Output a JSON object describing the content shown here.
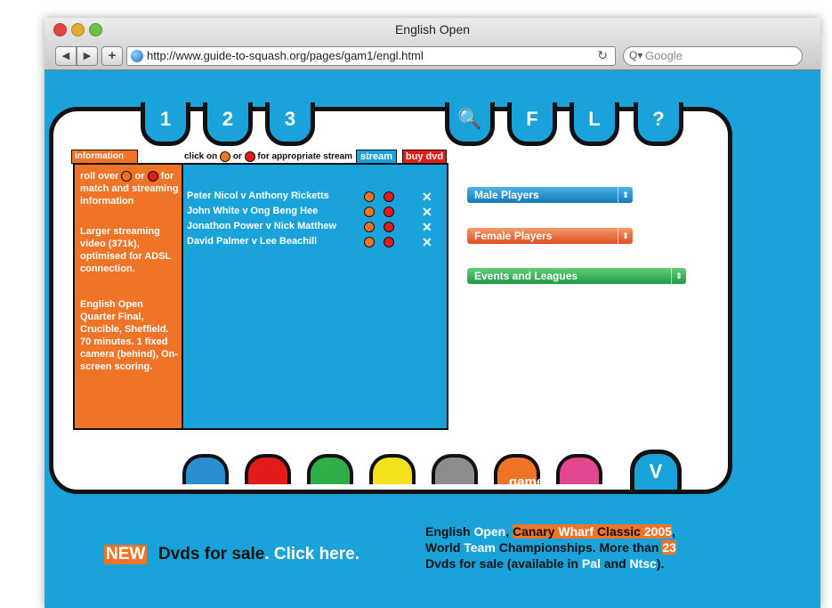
{
  "window": {
    "title": "English Open"
  },
  "toolbar": {
    "back": "◀",
    "forward": "▶",
    "add": "+",
    "url": "http://www.guide-to-squash.org/pages/gam1/engl.html",
    "reload": "↻",
    "search_placeholder": "Google",
    "search_icon": "Q▾"
  },
  "top_tabs": [
    "1",
    "2",
    "3",
    "🔍",
    "F",
    "L",
    "?"
  ],
  "info": {
    "tab": "information",
    "rollover_a": "roll over",
    "rollover_or": "or",
    "rollover_b": "for match and streaming information",
    "p2": "Larger streaming video (371k), optimised for ADSL connection.",
    "p3": "English Open Quarter Final, Crucible, Sheffield. 70 minutes. 1 fixed camera (behind), On-screen scoring."
  },
  "stream_header": {
    "click_on": "click on",
    "or": "or",
    "for": "for appropriate stream",
    "stream": "stream",
    "buy_dvd": "buy dvd"
  },
  "matches": [
    {
      "name": "Peter Nicol v Anthony Ricketts",
      "buy": "✕"
    },
    {
      "name": "John White v Ong Beng Hee",
      "buy": "✕"
    },
    {
      "name": "Jonathon Power v Nick Matthew",
      "buy": "✕"
    },
    {
      "name": "David Palmer v Lee Beachill",
      "buy": "✕"
    }
  ],
  "dropdowns": {
    "male": "Male Players",
    "female": "Female Players",
    "events": "Events and Leagues",
    "arrow": "⇕"
  },
  "bottom_tabs": {
    "game": "game",
    "v": "V"
  },
  "promo": {
    "new": "NEW",
    "left_a": "Dvds for sale",
    "left_b": ". Click here.",
    "line1_a": "English ",
    "line1_b": "Open",
    "line1_c": ", ",
    "line1_d": "Canary",
    "line1_e": " Wharf ",
    "line1_f": "Classic",
    "line1_g": " 2005",
    "line1_h": ",",
    "line2_a": "World ",
    "line2_b": "Team",
    "line2_c": " Championships. More than ",
    "line2_d": "23",
    "line3_a": "Dvds for sale (available in ",
    "line3_b": "Pal",
    "line3_c": " and ",
    "line3_d": "Ntsc",
    "line3_e": ")."
  },
  "colors": {
    "page_bg": "#1aa3db",
    "orange": "#f07428",
    "red": "#e21b1b"
  }
}
